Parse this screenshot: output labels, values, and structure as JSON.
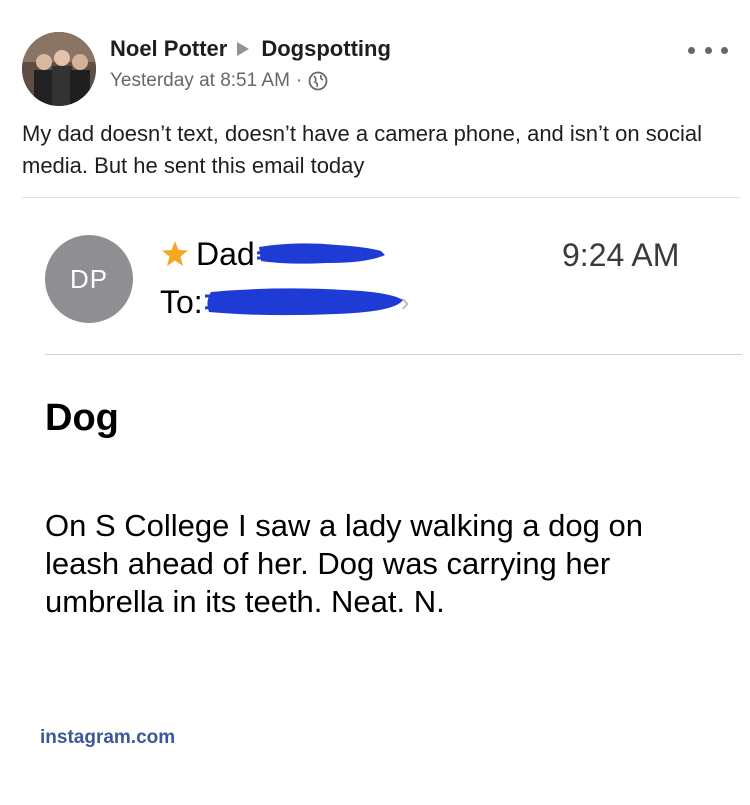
{
  "post": {
    "author": "Noel Potter",
    "group": "Dogspotting",
    "timestamp": "Yesterday at 8:51 AM",
    "separator": "·",
    "text": "My dad doesn’t text, doesn’t have a camera phone, and isn’t on social media. But he sent this email today"
  },
  "email": {
    "avatar_initials": "DP",
    "from_name": "Dad",
    "to_label": "To:",
    "time": "9:24 AM",
    "subject": "Dog",
    "body": "On S College I saw a lady walking a dog on leash ahead of her.  Dog was carrying her umbrella in its teeth.  Neat.  N."
  },
  "watermark": "instagram.com",
  "icons": {
    "group_arrow": "caret-right-icon",
    "privacy": "globe-icon",
    "menu": "more-icon",
    "favorite": "star-icon",
    "expand": "chevron-right-icon"
  },
  "colors": {
    "star": "#f5a623",
    "redaction": "#1f3bd6",
    "email_avatar": "#8e8e93",
    "watermark": "#3b5998"
  }
}
